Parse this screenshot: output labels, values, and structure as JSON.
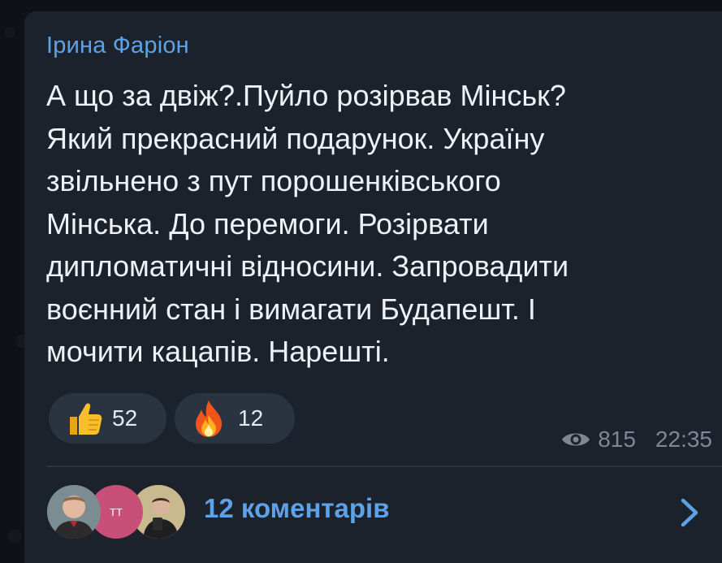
{
  "post": {
    "author": "Ірина Фаріон",
    "message_lines": [
      "А що за двіж?.Пуйло розірвав Мінськ?",
      "Який прекрасний подарунок. Україну",
      "звільнено з пут порошенківського",
      "Мінська. До перемоги. Розірвати",
      "дипломатичні відносини. Запровадити",
      "воєнний стан і вимагати Будапешт. І",
      "мочити кацапів. Нарешті."
    ],
    "views": "815",
    "time": "22:35"
  },
  "reactions": [
    {
      "icon": "thumbs-up-icon",
      "count": "52"
    },
    {
      "icon": "fire-icon",
      "count": "12"
    }
  ],
  "comments": {
    "label": "12 коментарів",
    "avatar_initials": "ТТ"
  },
  "colors": {
    "background": "#0e1116",
    "bubble": "#1b222c",
    "accent": "#5ea2e6",
    "text": "#eef1f5",
    "muted": "#7d8894",
    "reaction_bg": "#2a3340"
  }
}
